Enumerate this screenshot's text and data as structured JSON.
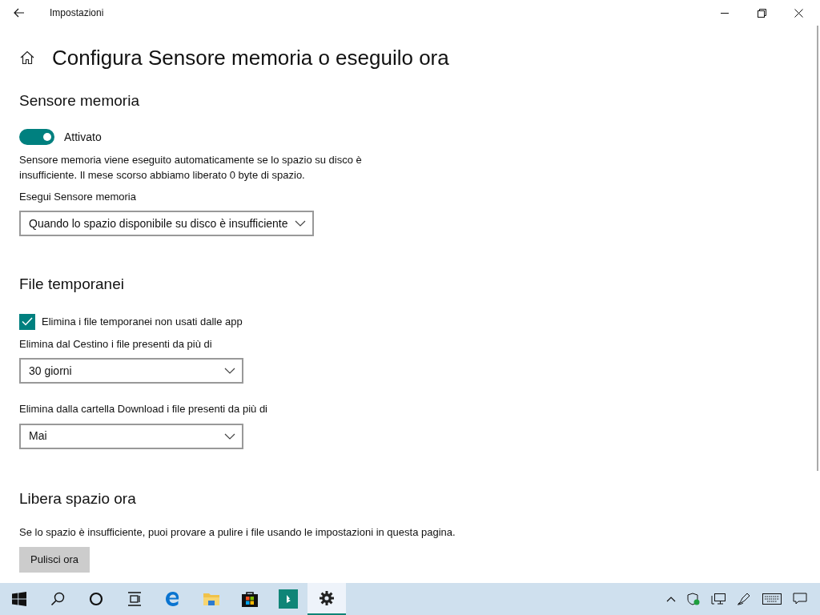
{
  "window": {
    "title": "Impostazioni"
  },
  "page_title": "Configura Sensore memoria o eseguilo ora",
  "storage_sense": {
    "heading": "Sensore memoria",
    "toggle": {
      "on": true,
      "label": "Attivato"
    },
    "description": "Sensore memoria viene eseguito automaticamente se lo spazio su disco è insufficiente. Il mese scorso abbiamo liberato 0 byte di spazio.",
    "run_label": "Esegui Sensore memoria",
    "run_value": "Quando lo spazio disponibile su disco è insufficiente"
  },
  "temp_files": {
    "heading": "File temporanei",
    "checkbox": {
      "checked": true,
      "label": "Elimina i file temporanei non usati dalle app"
    },
    "dropdowns": [
      {
        "label": "Elimina dal Cestino i file presenti da più di",
        "value": "30 giorni"
      },
      {
        "label": "Elimina dalla cartella Download i file presenti da più di",
        "value": "Mai"
      }
    ]
  },
  "free_now": {
    "heading": "Libera spazio ora",
    "description": "Se lo spazio è insufficiente, puoi provare a pulire i file usando le impostazioni in questa pagina.",
    "button": "Pulisci ora"
  },
  "taskbar": {
    "apps": [
      {
        "kind": "start",
        "selected": false
      },
      {
        "kind": "search",
        "selected": false
      },
      {
        "kind": "cortana",
        "selected": false
      },
      {
        "kind": "taskview",
        "selected": false
      },
      {
        "kind": "edge",
        "selected": false
      },
      {
        "kind": "explorer",
        "selected": false
      },
      {
        "kind": "store",
        "selected": false
      },
      {
        "kind": "app",
        "selected": false
      },
      {
        "kind": "settings",
        "selected": true
      }
    ]
  }
}
